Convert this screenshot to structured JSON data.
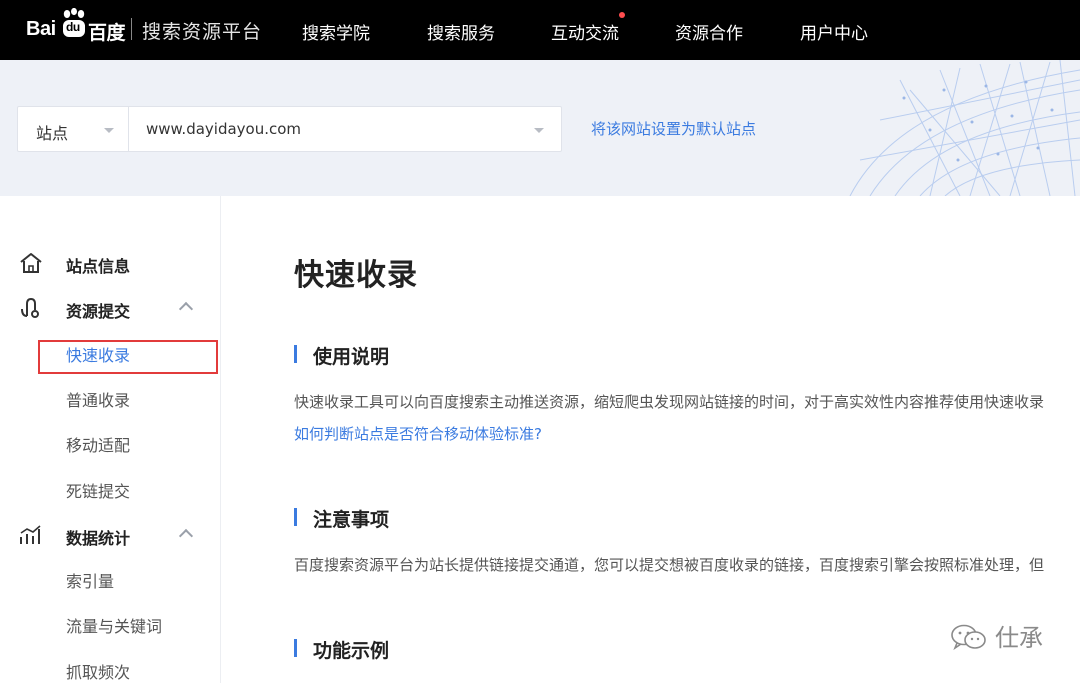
{
  "brand": {
    "logo_text_left": "Bai",
    "logo_text_du": "du",
    "logo_text_right": "百度",
    "platform_name": "搜索资源平台"
  },
  "nav": {
    "items": [
      {
        "label": "搜索学院"
      },
      {
        "label": "搜索服务"
      },
      {
        "label": "互动交流",
        "has_notification_dot": true
      },
      {
        "label": "资源合作"
      },
      {
        "label": "用户中心"
      }
    ]
  },
  "site_selector": {
    "type_label": "站点",
    "url": "www.dayidayou.com",
    "set_default_link": "将该网站设置为默认站点"
  },
  "sidebar": {
    "groups": [
      {
        "label": "站点信息",
        "icon": "home-icon",
        "expandable": false
      },
      {
        "label": "资源提交",
        "icon": "submit-icon",
        "expanded": true,
        "items": [
          {
            "label": "快速收录",
            "active": true
          },
          {
            "label": "普通收录"
          },
          {
            "label": "移动适配"
          },
          {
            "label": "死链提交"
          }
        ]
      },
      {
        "label": "数据统计",
        "icon": "stats-icon",
        "expanded": true,
        "items": [
          {
            "label": "索引量"
          },
          {
            "label": "流量与关键词"
          },
          {
            "label": "抓取频次"
          }
        ]
      }
    ]
  },
  "main": {
    "title": "快速收录",
    "sections": [
      {
        "title": "使用说明",
        "text": "快速收录工具可以向百度搜索主动推送资源，缩短爬虫发现网站链接的时间，对于高实效性内容推荐使用快速收录",
        "link": "如何判断站点是否符合移动体验标准?"
      },
      {
        "title": "注意事项",
        "text": "百度搜索资源平台为站长提供链接提交通道，您可以提交想被百度收录的链接，百度搜索引擎会按照标准处理，但"
      },
      {
        "title": "功能示例"
      }
    ]
  },
  "watermark": {
    "text": "仕承",
    "icon": "wechat-icon"
  },
  "colors": {
    "accent": "#3b7be0",
    "nav_bg": "#000000",
    "highlight": "#e23b3b"
  }
}
